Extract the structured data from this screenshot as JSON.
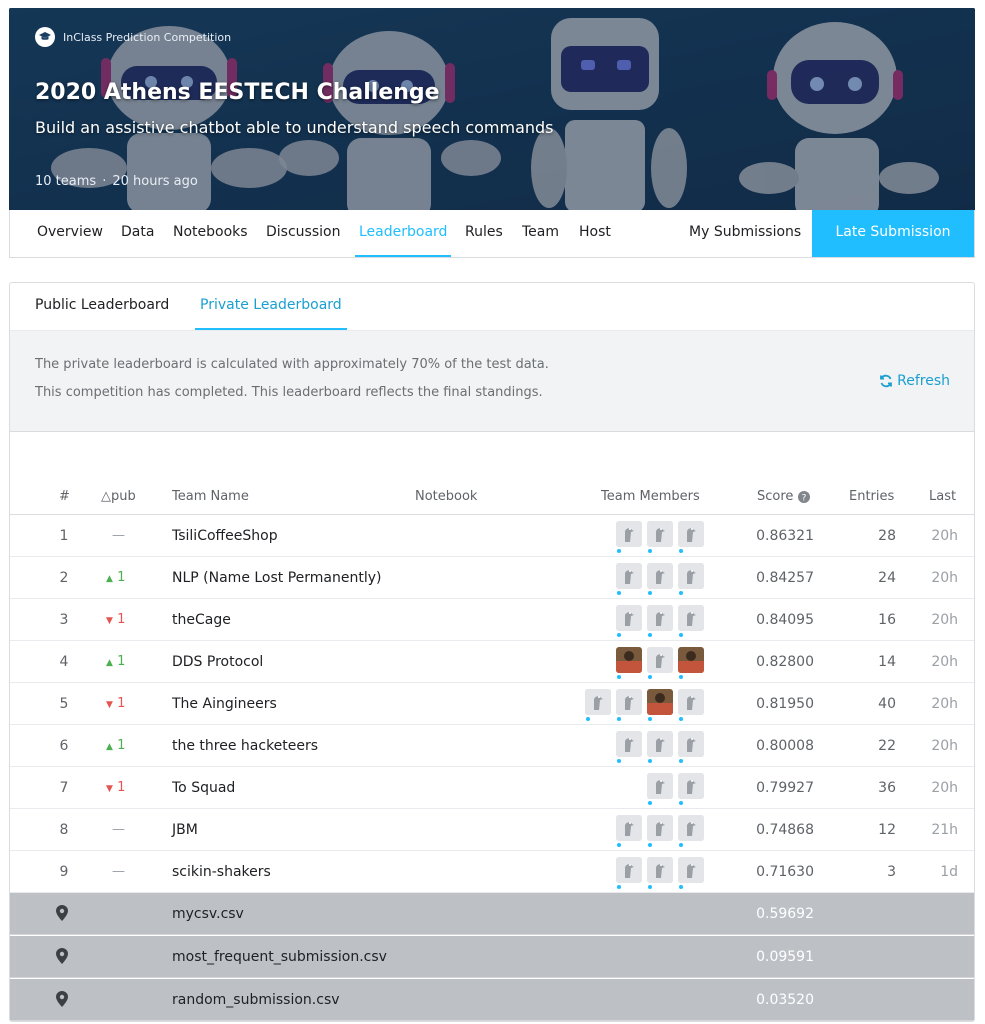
{
  "competition": {
    "kicker": "InClass Prediction Competition",
    "title": "2020 Athens EESTECH Challenge",
    "subtitle": "Build an assistive chatbot able to understand speech commands",
    "teams": "10 teams",
    "separator": "·",
    "updated": "20 hours ago"
  },
  "nav": {
    "items": [
      "Overview",
      "Data",
      "Notebooks",
      "Discussion",
      "Leaderboard",
      "Rules",
      "Team",
      "Host"
    ],
    "active": "Leaderboard",
    "my_submissions": "My Submissions",
    "late_submission": "Late Submission"
  },
  "leaderboard": {
    "tabs": [
      "Public Leaderboard",
      "Private Leaderboard"
    ],
    "active_tab": "Private Leaderboard",
    "notice_line1": "The private leaderboard is calculated with approximately 70% of the test data.",
    "notice_line2": "This competition has completed. This leaderboard reflects the final standings.",
    "refresh": "Refresh",
    "columns": {
      "rank": "#",
      "delta": "△pub",
      "team": "Team Name",
      "notebook": "Notebook",
      "members": "Team Members",
      "score": "Score",
      "entries": "Entries",
      "last": "Last"
    },
    "rows": [
      {
        "rank": "1",
        "delta": "—",
        "trend": "same",
        "team": "TsiliCoffeeShop",
        "members": 3,
        "score": "0.86321",
        "entries": "28",
        "last": "20h"
      },
      {
        "rank": "2",
        "delta": "1",
        "trend": "up",
        "team": "NLP (Name Lost Permanently)",
        "members": 3,
        "score": "0.84257",
        "entries": "24",
        "last": "20h"
      },
      {
        "rank": "3",
        "delta": "1",
        "trend": "down",
        "team": "theCage",
        "members": 3,
        "score": "0.84095",
        "entries": "16",
        "last": "20h"
      },
      {
        "rank": "4",
        "delta": "1",
        "trend": "up",
        "team": "DDS Protocol",
        "members": 3,
        "score": "0.82800",
        "entries": "14",
        "last": "20h"
      },
      {
        "rank": "5",
        "delta": "1",
        "trend": "down",
        "team": "The Aingineers",
        "members": 4,
        "score": "0.81950",
        "entries": "40",
        "last": "20h"
      },
      {
        "rank": "6",
        "delta": "1",
        "trend": "up",
        "team": "the three hacketeers",
        "members": 3,
        "score": "0.80008",
        "entries": "22",
        "last": "20h"
      },
      {
        "rank": "7",
        "delta": "1",
        "trend": "down",
        "team": "To Squad",
        "members": 2,
        "score": "0.79927",
        "entries": "36",
        "last": "20h"
      },
      {
        "rank": "8",
        "delta": "—",
        "trend": "same",
        "team": "JBM",
        "members": 3,
        "score": "0.74868",
        "entries": "12",
        "last": "21h"
      },
      {
        "rank": "9",
        "delta": "—",
        "trend": "same",
        "team": "scikin-shakers",
        "members": 3,
        "score": "0.71630",
        "entries": "3",
        "last": "1d"
      }
    ],
    "benchmarks": [
      {
        "name": "mycsv.csv",
        "score": "0.59692"
      },
      {
        "name": "most_frequent_submission.csv",
        "score": "0.09591"
      },
      {
        "name": "random_submission.csv",
        "score": "0.03520"
      }
    ]
  },
  "colors": {
    "accent": "#20beff",
    "accent_text": "#1a9fd0",
    "up": "#4caf50",
    "down": "#e5554f",
    "benchmark_row": "#bdc1c6",
    "banner": "#1b3f63"
  }
}
